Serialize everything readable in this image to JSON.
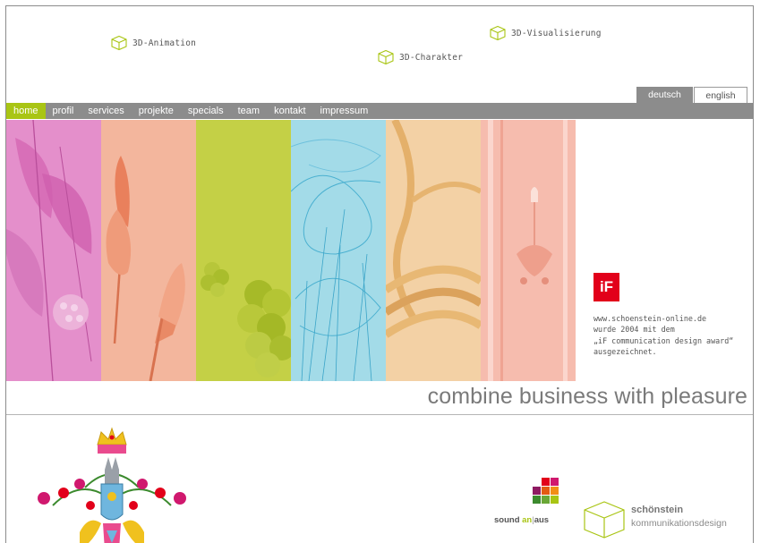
{
  "top_links": [
    {
      "label": "3D-Animation"
    },
    {
      "label": "3D-Charakter"
    },
    {
      "label": "3D-Visualisierung"
    }
  ],
  "languages": {
    "active": "deutsch",
    "other": "english"
  },
  "nav": [
    {
      "label": "home",
      "active": true
    },
    {
      "label": "profil"
    },
    {
      "label": "services"
    },
    {
      "label": "projekte"
    },
    {
      "label": "specials"
    },
    {
      "label": "team"
    },
    {
      "label": "kontakt"
    },
    {
      "label": "impressum"
    }
  ],
  "award": {
    "logo": "iF",
    "lines": [
      "www.schoenstein-online.de",
      "wurde 2004 mit dem",
      "„iF communication design award“",
      "ausgezeichnet."
    ]
  },
  "slogan": "combine business with pleasure",
  "sound": {
    "word": "sound",
    "on": "an",
    "sep": "|",
    "off": "aus"
  },
  "brand": {
    "name": "schönstein",
    "sub": "kommunikationsdesign"
  },
  "colors": {
    "accent": "#a9c514",
    "nav_bg": "#8c8c8c",
    "text_gray": "#555555",
    "iF_red": "#e2001a",
    "strips": [
      "#e28fc9",
      "#f1b49a",
      "#c6d24c",
      "#9ed8e6",
      "#f2cfa1",
      "#f5b8ab"
    ],
    "squares": [
      "#e2001a",
      "#d0186e",
      "#8e1a62",
      "#a52a1e",
      "#e25a12",
      "#f28e16",
      "#3c8a2e",
      "#6aa736",
      "#a9c514"
    ]
  },
  "icons": [
    "cube-icon",
    "if-award-logo",
    "coat-of-arms",
    "color-squares-logo"
  ]
}
